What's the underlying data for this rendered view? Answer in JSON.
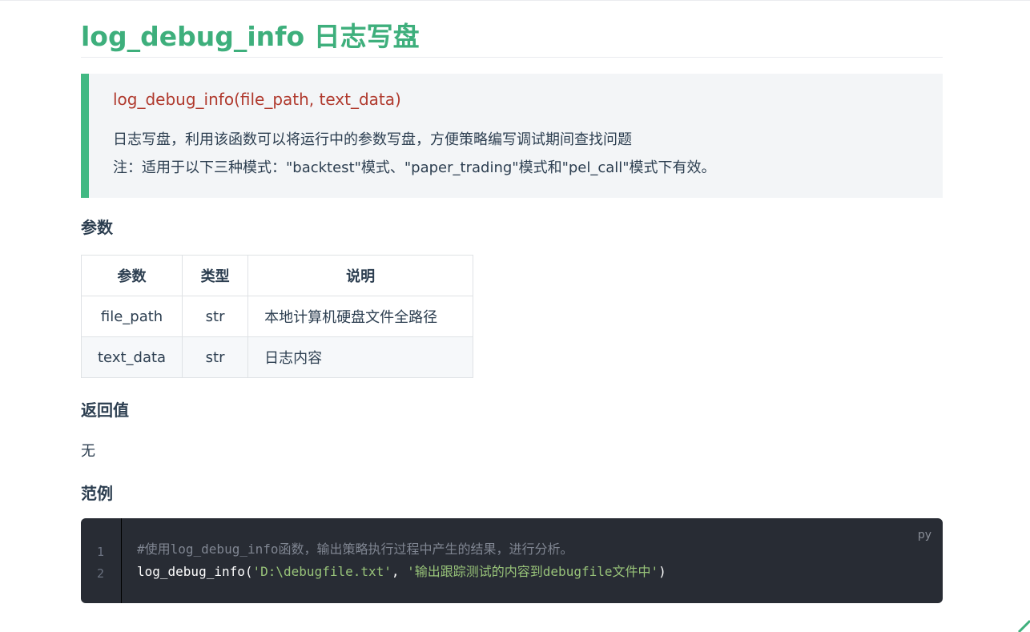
{
  "page": {
    "title": "log_debug_info 日志写盘"
  },
  "callout": {
    "signature": "log_debug_info(file_path, text_data)",
    "description": "日志写盘，利用该函数可以将运行中的参数写盘，方便策略编写调试期间查找问题",
    "note": "注：适用于以下三种模式：\"backtest\"模式、\"paper_trading\"模式和\"pel_call\"模式下有效。"
  },
  "sections": {
    "params_heading": "参数",
    "returns_heading": "返回值",
    "returns_value": "无",
    "example_heading": "范例"
  },
  "params_table": {
    "headers": [
      "参数",
      "类型",
      "说明"
    ],
    "rows": [
      [
        "file_path",
        "str",
        "本地计算机硬盘文件全路径"
      ],
      [
        "text_data",
        "str",
        "日志内容"
      ]
    ]
  },
  "code": {
    "language": "py",
    "line_numbers": [
      "1",
      "2"
    ],
    "line1_comment": "#使用log_debug_info函数，输出策略执行过程中产生的结果，进行分析。",
    "line2_fn": "log_debug_info",
    "line2_open": "(",
    "line2_arg1": "'D:\\debugfile.txt'",
    "line2_sep": ", ",
    "line2_arg2": "'输出跟踪测试的内容到debugfile文件中'",
    "line2_close": ")"
  },
  "colors": {
    "accent": "#3eaf7c",
    "callout_border": "#42b983",
    "signature": "#b03a2e",
    "code_bg": "#282c34",
    "code_string": "#98c379"
  }
}
